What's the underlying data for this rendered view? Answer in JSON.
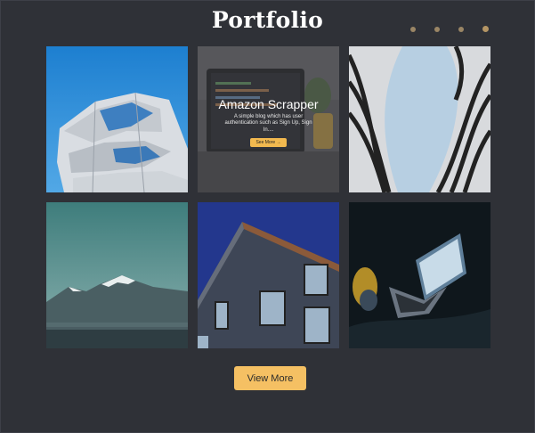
{
  "section": {
    "title": "Portfolio"
  },
  "carousel": {
    "dots": 4,
    "active_dot": 3
  },
  "projects": [
    {
      "overlay": null
    },
    {
      "overlay": {
        "title": "Amazon Scrapper",
        "description": "A simple blog which has user authentication such as Sign Up, Sign In....",
        "button_label": "See More →"
      }
    },
    {
      "overlay": null
    },
    {
      "overlay": null
    },
    {
      "overlay": null
    },
    {
      "overlay": null
    }
  ],
  "view_more": {
    "label": "View More"
  },
  "colors": {
    "background": "#2f3137",
    "accent": "#f5c063",
    "dot": "#9a8565"
  }
}
